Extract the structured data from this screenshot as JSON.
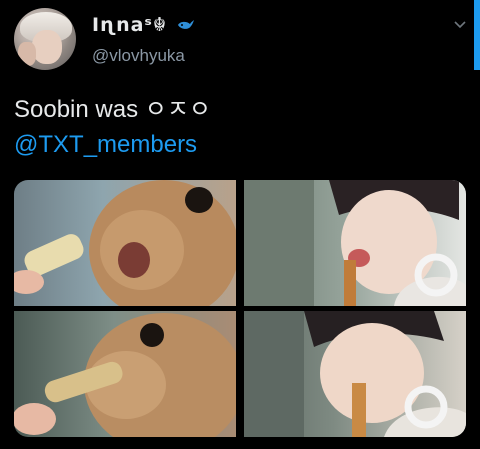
{
  "tweet": {
    "display_name": "Iɳnaˢ☬",
    "handle": "@vlovhyuka",
    "text_line1": "Soobin was ㅇㅈㅇ",
    "mention": "@TXT_members"
  },
  "icons": {
    "name_emoji": "whale-icon",
    "menu": "chevron-down-icon"
  },
  "colors": {
    "background": "#000000",
    "text": "#e7e9ea",
    "secondary_text": "#8b98a5",
    "link": "#1d9bf0"
  },
  "media": {
    "tiles": [
      {
        "content": "rabbit-biting-snack-1"
      },
      {
        "content": "person-biting-snack-1"
      },
      {
        "content": "rabbit-biting-snack-2"
      },
      {
        "content": "person-biting-snack-2"
      }
    ]
  }
}
